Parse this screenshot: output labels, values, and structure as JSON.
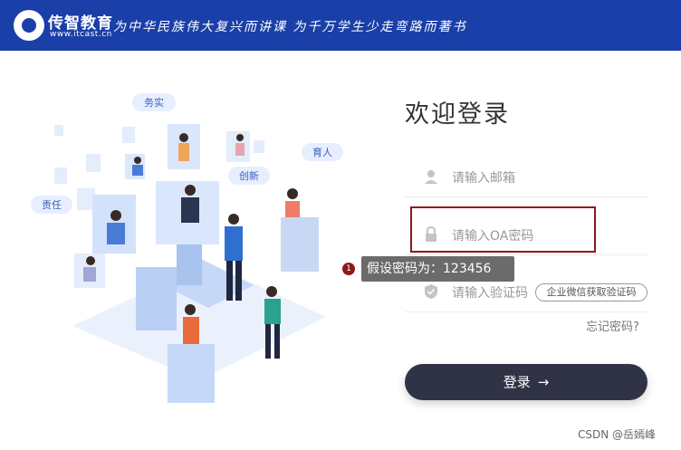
{
  "header": {
    "logo_title": "传智教育",
    "logo_url": "www.itcast.cn",
    "slogan": "为中华民族伟大复兴而讲课 为千万学生少走弯路而著书",
    "bg_color": "#1a3fa8"
  },
  "illustration": {
    "tags": [
      "务实",
      "育人",
      "创新",
      "责任"
    ]
  },
  "login": {
    "title": "欢迎登录",
    "email_placeholder": "请输入邮箱",
    "password_placeholder": "请输入OA密码",
    "code_placeholder": "请输入验证码",
    "code_button": "企业微信获取验证码",
    "forgot": "忘记密码?",
    "submit": "登录",
    "submit_arrow": "→",
    "button_color": "#2f3345"
  },
  "annotation": {
    "badge": "1",
    "text": "假设密码为：123456",
    "color": "#8b1a1a"
  },
  "watermark": "CSDN @岳嫣峰",
  "icons": {
    "email": "user-icon",
    "password": "lock-icon",
    "code": "shield-icon"
  }
}
